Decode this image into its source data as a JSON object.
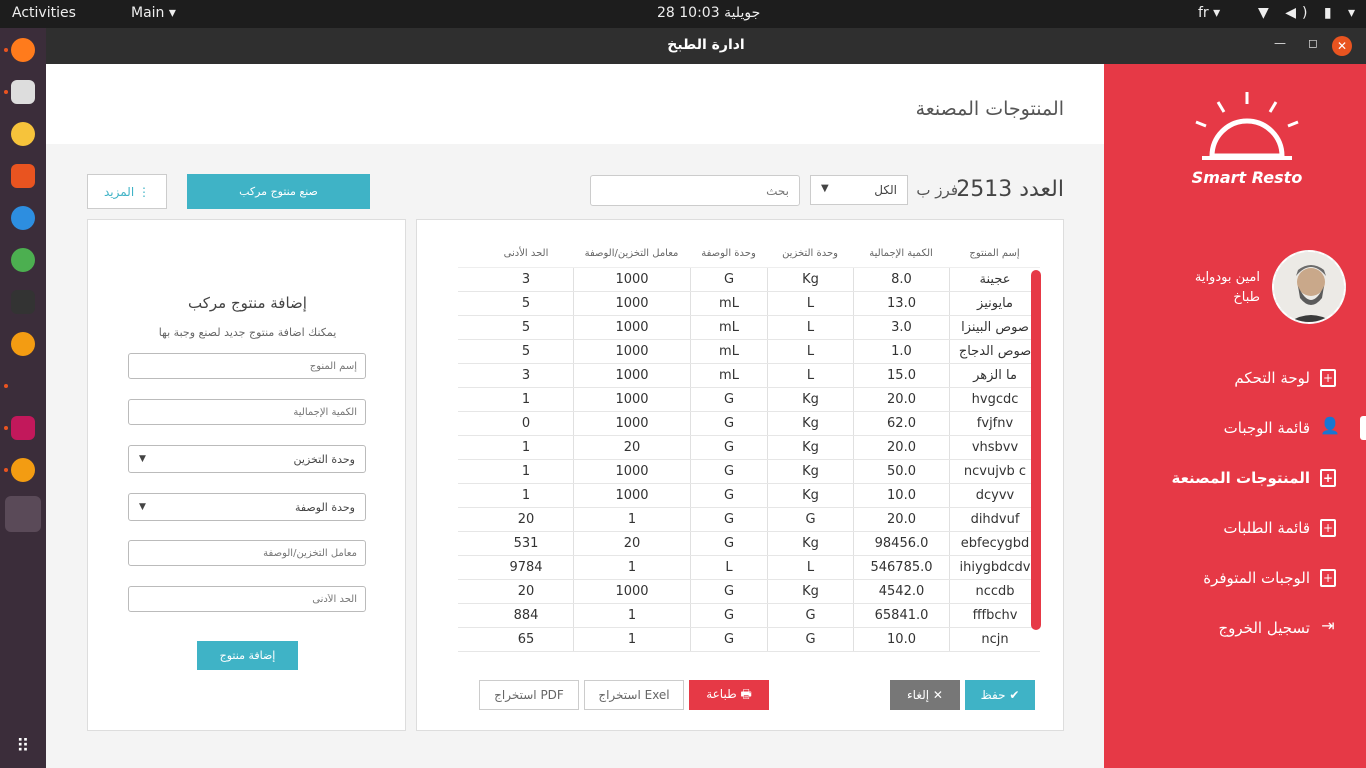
{
  "topbar": {
    "activities": "Activities",
    "main_menu": "Main ▾",
    "clock": "28 جويلية 10:03",
    "lang": "fr ▾",
    "tray": "▼ ◀) ▮ ▾"
  },
  "window": {
    "title": "ادارة الطبخ"
  },
  "header": {
    "page_title": "المنتوجات المصنعة"
  },
  "sidebar": {
    "logo_text": "Smart Resto",
    "user_name": "امين بودواية",
    "user_role": "طباخ",
    "items": [
      {
        "label": "لوحة التحكم",
        "icon": "plus-file-icon"
      },
      {
        "label": "قائمة الوجبات",
        "icon": "user-add-icon"
      },
      {
        "label": "المنتوجات المصنعة",
        "icon": "plus-file-icon"
      },
      {
        "label": "قائمة الطلبات",
        "icon": "plus-file-icon"
      },
      {
        "label": "الوجبات المتوفرة",
        "icon": "plus-file-icon"
      },
      {
        "label": "تسجيل الخروج",
        "icon": "logout-icon"
      }
    ]
  },
  "toolbar": {
    "count_label": "العدد 2513",
    "sort_label": "فرز ب",
    "sort_value": "الكل",
    "search_placeholder": "بحث",
    "compose_label": "صنع منتوج مركب",
    "more_label": "المزيد ⋮"
  },
  "table": {
    "headers": [
      "إسم المنتوج",
      "الكمية الإجمالية",
      "وحدة التخزين",
      "وحدة الوصفة",
      "معامل التخزين/الوصفة",
      "الحد الأدنى"
    ],
    "rows": [
      [
        "عجينة",
        "8.0",
        "Kg",
        "G",
        "1000",
        "3"
      ],
      [
        "مايونيز",
        "13.0",
        "L",
        "mL",
        "1000",
        "5"
      ],
      [
        "صوص البينزا",
        "3.0",
        "L",
        "mL",
        "1000",
        "5"
      ],
      [
        "صوص الدجاج",
        "1.0",
        "L",
        "mL",
        "1000",
        "5"
      ],
      [
        "ما الزهر",
        "15.0",
        "L",
        "mL",
        "1000",
        "3"
      ],
      [
        "hvgcdc",
        "20.0",
        "Kg",
        "G",
        "1000",
        "1"
      ],
      [
        "fvjfnv",
        "62.0",
        "Kg",
        "G",
        "1000",
        "0"
      ],
      [
        "vhsbvv",
        "20.0",
        "Kg",
        "G",
        "20",
        "1"
      ],
      [
        "ncvujvb c",
        "50.0",
        "Kg",
        "G",
        "1000",
        "1"
      ],
      [
        "dcyvv",
        "10.0",
        "Kg",
        "G",
        "1000",
        "1"
      ],
      [
        "dihdvuf",
        "20.0",
        "G",
        "G",
        "1",
        "20"
      ],
      [
        "ebfecygbd",
        "98456.0",
        "Kg",
        "G",
        "20",
        "531"
      ],
      [
        "ihiygbdcdv",
        "546785.0",
        "L",
        "L",
        "1",
        "9784"
      ],
      [
        "nccdb",
        "4542.0",
        "Kg",
        "G",
        "1000",
        "20"
      ],
      [
        "fffbchv",
        "65841.0",
        "G",
        "G",
        "1",
        "884"
      ],
      [
        "ncjn",
        "10.0",
        "G",
        "G",
        "1",
        "65"
      ]
    ]
  },
  "actions": {
    "save": "حفظ ✔",
    "cancel": "إلغاء ✕",
    "print": "طباعة 🖶",
    "excel": "استخراج Exel",
    "pdf": "استخراج PDF"
  },
  "form": {
    "title": "إضافة منتوج مركب",
    "subtitle": "يمكنك اضافة منتوج جديد لصنع وجبة بها",
    "name_placeholder": "إسم المنوج",
    "qty_placeholder": "الكمية الإجمالية",
    "storage_unit": "وحدة التخزين",
    "recipe_unit": "وحدة الوصفة",
    "factor_placeholder": "معامل التخزين/الوصفة",
    "min_placeholder": "الحد الأدنى",
    "submit": "إضافة منتوج"
  },
  "colors": {
    "accent": "#e63946",
    "teal": "#3fb3c6"
  }
}
